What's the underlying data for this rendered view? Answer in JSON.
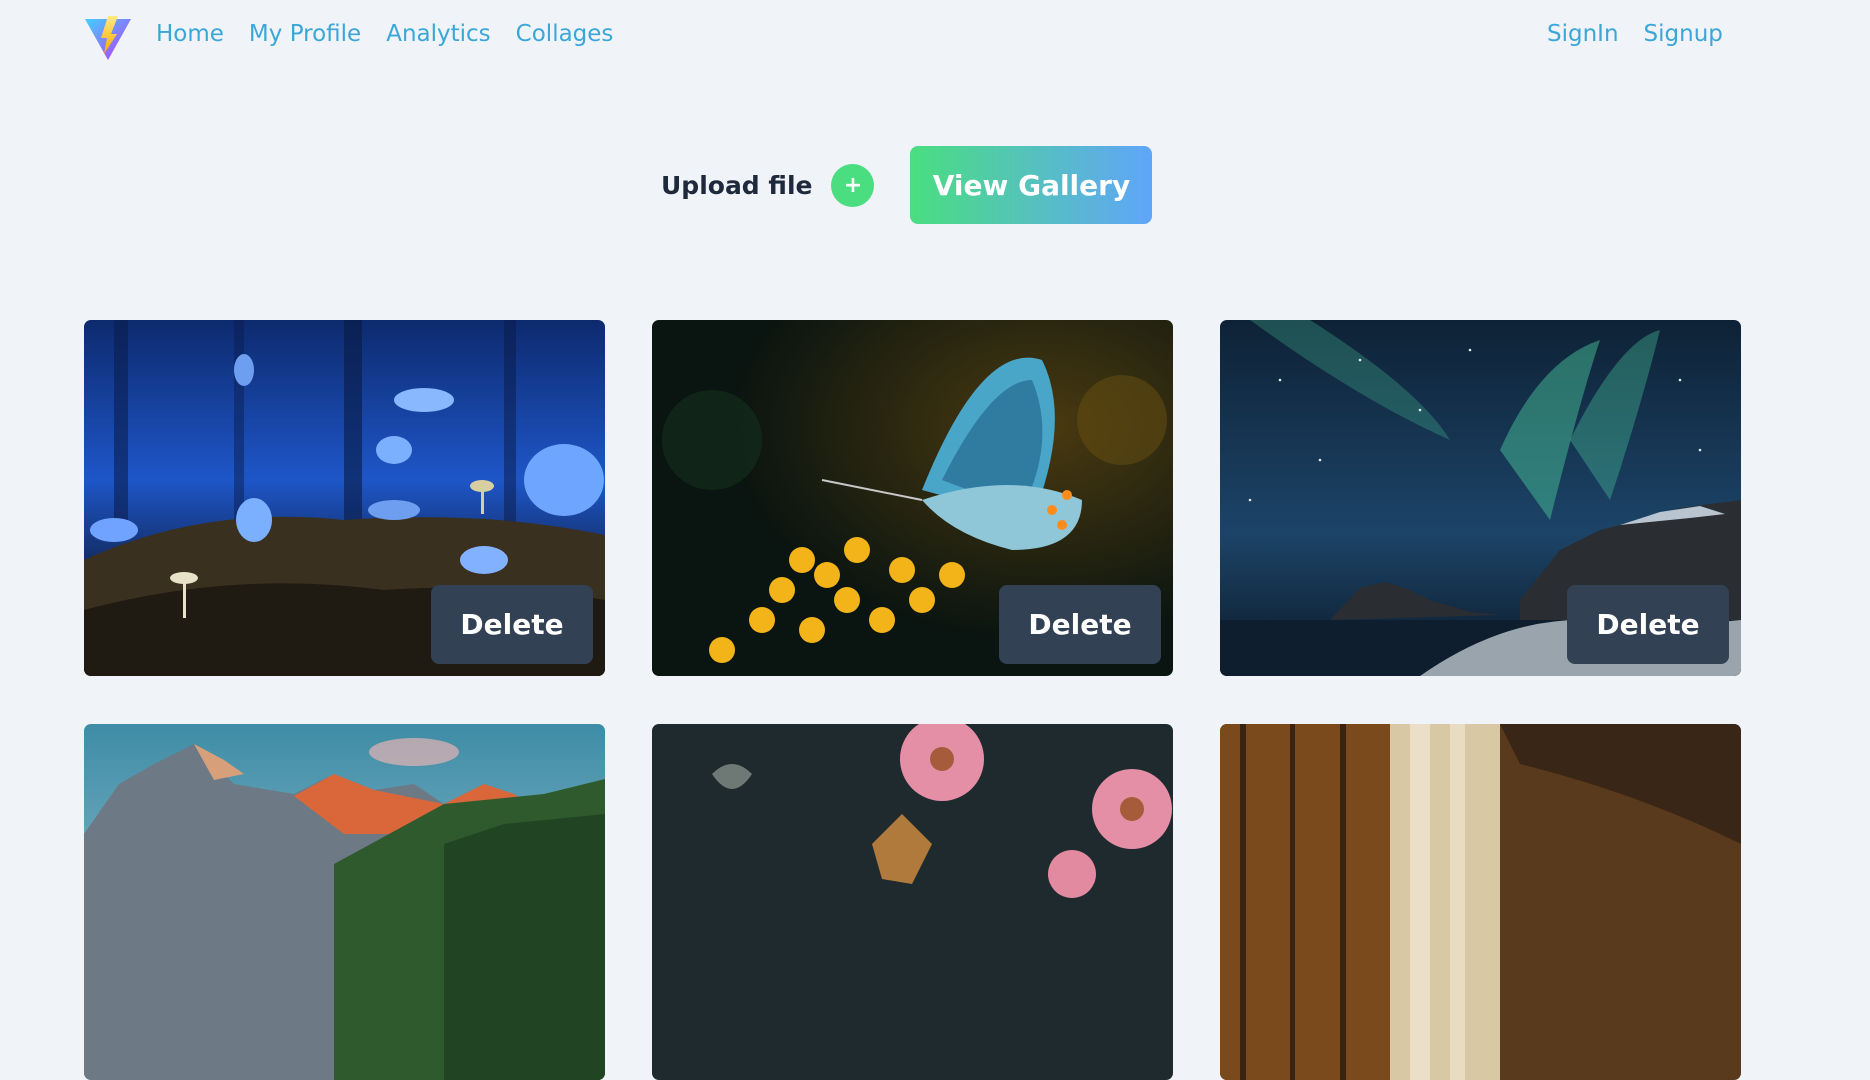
{
  "nav": {
    "left": [
      "Home",
      "My Profile",
      "Analytics",
      "Collages"
    ],
    "right": [
      "SignIn",
      "Signup"
    ]
  },
  "upload": {
    "label": "Upload file",
    "plus": "+",
    "gallery": "View Gallery"
  },
  "cards": [
    {
      "delete": "Delete"
    },
    {
      "delete": "Delete"
    },
    {
      "delete": "Delete"
    }
  ]
}
